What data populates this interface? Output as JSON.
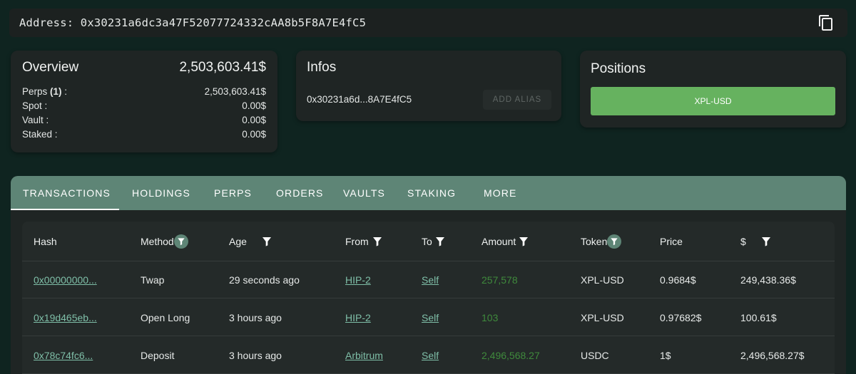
{
  "address": {
    "label": "Address: 0x30231a6dc3a47F52077724332cAA8b5F8A7E4fC5",
    "copy_icon": "copy-icon"
  },
  "overview": {
    "title": "Overview",
    "total": "2,503,603.41$",
    "rows": [
      {
        "label_pre": "Perps ",
        "label_strong": "(1)",
        "label_post": " :",
        "value": "2,503,603.41$"
      },
      {
        "label_pre": "Spot :",
        "label_strong": "",
        "label_post": "",
        "value": "0.00$"
      },
      {
        "label_pre": "Vault :",
        "label_strong": "",
        "label_post": "",
        "value": "0.00$"
      },
      {
        "label_pre": "Staked :",
        "label_strong": "",
        "label_post": "",
        "value": "0.00$"
      }
    ]
  },
  "infos": {
    "title": "Infos",
    "short_address": "0x30231a6d...8A7E4fC5",
    "alias_button": "ADD ALIAS"
  },
  "positions": {
    "title": "Positions",
    "items": [
      "XPL-USD"
    ]
  },
  "tabs": [
    "TRANSACTIONS",
    "HOLDINGS",
    "PERPS",
    "ORDERS",
    "VAULTS",
    "STAKING",
    "MORE"
  ],
  "active_tab": "TRANSACTIONS",
  "table": {
    "headers": [
      "Hash",
      "Method",
      "Age",
      "From",
      "To",
      "Amount",
      "Token",
      "Price",
      "$"
    ],
    "rows": [
      {
        "hash": "0x00000000...",
        "method": "Twap",
        "age": "29 seconds ago",
        "from": "HIP-2",
        "to": "Self",
        "amount": "257,578",
        "token": "XPL-USD",
        "price": "0.9684$",
        "usd": "249,438.36$"
      },
      {
        "hash": "0x19d465eb...",
        "method": "Open Long",
        "age": "3 hours ago",
        "from": "HIP-2",
        "to": "Self",
        "amount": "103",
        "token": "XPL-USD",
        "price": "0.97682$",
        "usd": "100.61$"
      },
      {
        "hash": "0x78c74fc6...",
        "method": "Deposit",
        "age": "3 hours ago",
        "from": "Arbitrum",
        "to": "Self",
        "amount": "2,496,568.27",
        "token": "USDC",
        "price": "1$",
        "usd": "2,496,568.27$"
      }
    ]
  },
  "colors": {
    "background": "#0f2420",
    "card": "#1f2524",
    "tab_bar": "#5e8576",
    "position_button": "#66b25f",
    "link": "#7fbfa8",
    "amount": "#3f8a3c"
  }
}
